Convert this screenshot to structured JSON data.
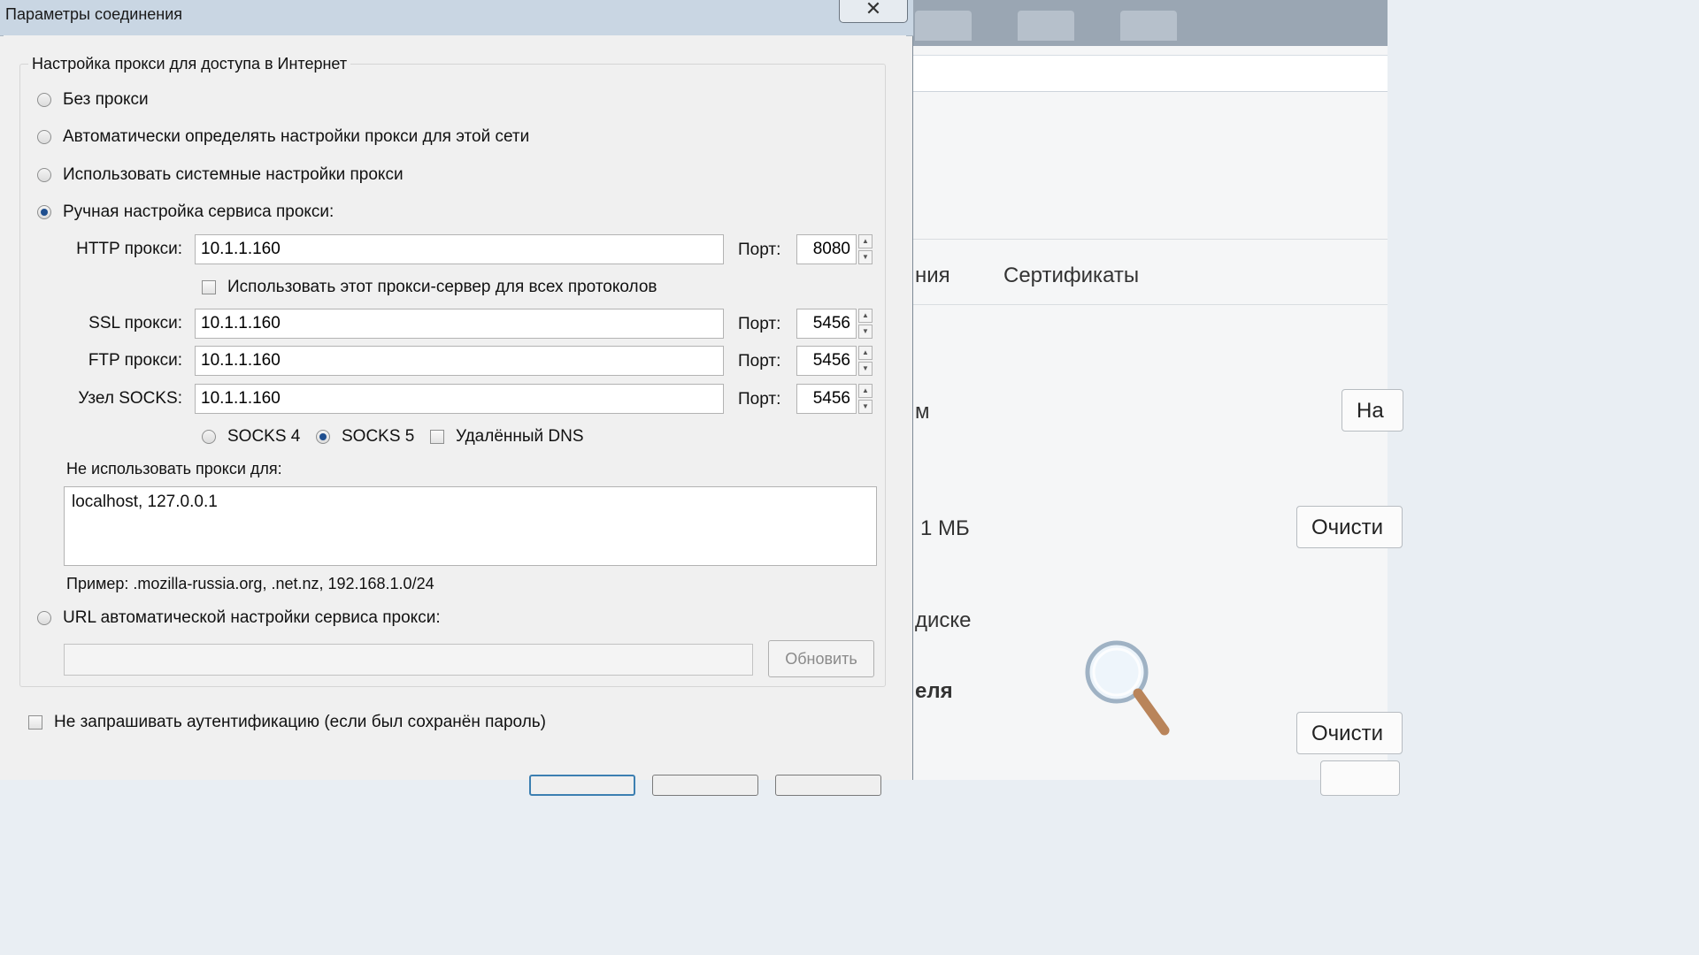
{
  "dialog": {
    "title": "Параметры соединения",
    "close_glyph": "✕"
  },
  "group": {
    "legend": "Настройка прокси для доступа в Интернет"
  },
  "options": {
    "no_proxy": "Без прокси",
    "auto_detect": "Автоматически определять настройки прокси для этой сети",
    "system": "Использовать системные настройки прокси",
    "manual": "Ручная настройка сервиса прокси:",
    "selected": "manual"
  },
  "http": {
    "label": "HTTP прокси:",
    "value": "10.1.1.160",
    "port_label": "Порт:",
    "port": "8080"
  },
  "all_protocols": {
    "label": "Использовать этот прокси-сервер для всех протоколов",
    "checked": false
  },
  "ssl": {
    "label": "SSL прокси:",
    "value": "10.1.1.160",
    "port_label": "Порт:",
    "port": "5456"
  },
  "ftp": {
    "label": "FTP прокси:",
    "value": "10.1.1.160",
    "port_label": "Порт:",
    "port": "5456"
  },
  "socks": {
    "label": "Узел SOCKS:",
    "value": "10.1.1.160",
    "port_label": "Порт:",
    "port": "5456"
  },
  "socks_version": {
    "v4": "SOCKS 4",
    "v5": "SOCKS 5",
    "selected": "v5"
  },
  "remote_dns": {
    "label": "Удалённый DNS",
    "checked": false
  },
  "no_proxy_for": {
    "label": "Не использовать прокси для:",
    "value": "localhost, 127.0.0.1",
    "example": "Пример: .mozilla-russia.org, .net.nz, 192.168.1.0/24"
  },
  "pac": {
    "label": "URL автоматической настройки сервиса прокси:",
    "value": "",
    "update_label": "Обновить"
  },
  "no_auth_prompt": {
    "label": "Не запрашивать аутентификацию (если был сохранён пароль)",
    "checked": false
  },
  "background": {
    "tab_partial": "ния",
    "tab_certificates": "Сертификаты",
    "frag_m": "м",
    "button_partial": "На",
    "cache_size": "1 МБ",
    "clear_button": "Очисти",
    "disk_partial": "диске",
    "heading_partial": "еля",
    "clear_button2": "Очисти"
  }
}
